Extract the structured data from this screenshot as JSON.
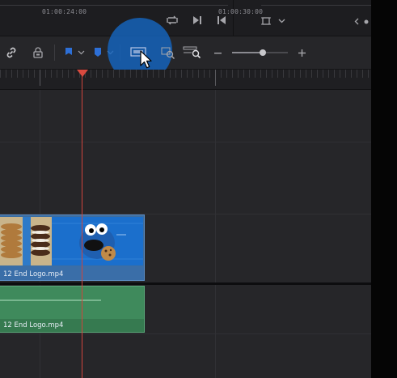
{
  "ruler": {
    "timecode_left": "01:00:24:00",
    "timecode_right": "01:00:30:00"
  },
  "clips": {
    "video_label": "12 End Logo.mp4",
    "audio_label": "12 End Logo.mp4"
  },
  "icons": {
    "player": [
      "loop-icon",
      "skip-next-icon",
      "skip-previous-icon",
      "crop-icon",
      "chevron-down-icon",
      "chevron-left-icon"
    ],
    "toolbar": [
      "link-icon",
      "lock-icon",
      "flag-icon",
      "chevron-down-icon",
      "marker-icon",
      "chevron-down-icon",
      "full-extent-zoom-icon",
      "detail-zoom-icon",
      "custom-zoom-icon",
      "zoom-out-icon",
      "zoom-slider",
      "zoom-in-icon"
    ]
  },
  "colors": {
    "playhead": "#d94a3f",
    "video_clip": "#3c6da0",
    "audio_clip": "#3f8a5c",
    "flag": "#2d6fd6",
    "click_highlight": "#1565c0"
  },
  "zoom": {
    "slider_value": 0.55
  }
}
